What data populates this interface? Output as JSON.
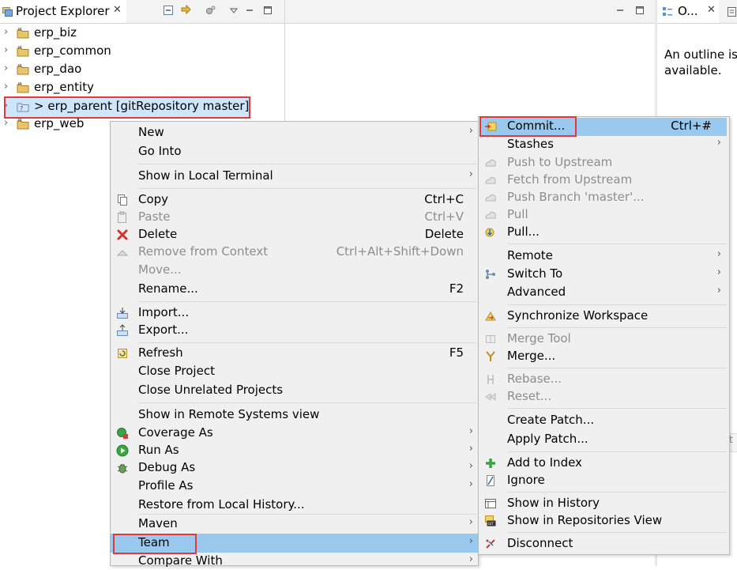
{
  "project_explorer": {
    "title": "Project Explorer",
    "close_glyph": "✕",
    "toolbar_icons": [
      "collapse-all-icon",
      "link-with-editor-icon",
      "filters-icon",
      "view-menu-icon",
      "minimize-icon",
      "maximize-icon"
    ],
    "items": [
      {
        "label": "erp_biz"
      },
      {
        "label": "erp_common"
      },
      {
        "label": "erp_dao"
      },
      {
        "label": "erp_entity"
      },
      {
        "label": "> erp_parent [gitRepository master]",
        "selected": true
      },
      {
        "label": "erp_web"
      }
    ]
  },
  "outline": {
    "title": "O...",
    "close_glyph": "✕",
    "message": "An outline is available.",
    "fragment": "t"
  },
  "editor": {
    "toolbar_icons": [
      "minimize-icon",
      "maximize-icon"
    ]
  },
  "context_menu": {
    "items": [
      {
        "label": "New",
        "submenu": true
      },
      {
        "label": "Go Into"
      },
      {
        "label": "Show in Local Terminal",
        "submenu": true
      },
      {
        "label": "Copy",
        "shortcut": "Ctrl+C",
        "icon": "copy-icon"
      },
      {
        "label": "Paste",
        "shortcut": "Ctrl+V",
        "icon": "paste-icon",
        "disabled": true
      },
      {
        "label": "Delete",
        "shortcut": "Delete",
        "icon": "delete-icon"
      },
      {
        "label": "Remove from Context",
        "shortcut": "Ctrl+Alt+Shift+Down",
        "icon": "remove-context-icon",
        "disabled": true
      },
      {
        "label": "Move...",
        "disabled": true
      },
      {
        "label": "Rename...",
        "shortcut": "F2"
      },
      {
        "label": "Import...",
        "icon": "import-icon"
      },
      {
        "label": "Export...",
        "icon": "export-icon"
      },
      {
        "label": "Refresh",
        "shortcut": "F5",
        "icon": "refresh-icon"
      },
      {
        "label": "Close Project"
      },
      {
        "label": "Close Unrelated Projects"
      },
      {
        "label": "Show in Remote Systems view"
      },
      {
        "label": "Coverage As",
        "submenu": true,
        "icon": "coverage-icon"
      },
      {
        "label": "Run As",
        "submenu": true,
        "icon": "run-icon"
      },
      {
        "label": "Debug As",
        "submenu": true,
        "icon": "debug-icon"
      },
      {
        "label": "Profile As",
        "submenu": true
      },
      {
        "label": "Restore from Local History..."
      },
      {
        "label": "Maven",
        "submenu": true
      },
      {
        "label": "Team",
        "submenu": true,
        "highlighted": true
      },
      {
        "label": "Compare With",
        "submenu": true
      }
    ]
  },
  "team_submenu": {
    "items": [
      {
        "label": "Commit...",
        "shortcut": "Ctrl+#",
        "icon": "commit-icon",
        "highlighted": true
      },
      {
        "label": "Stashes",
        "submenu": true
      },
      {
        "label": "Push to Upstream",
        "icon": "push-icon",
        "disabled": true
      },
      {
        "label": "Fetch from Upstream",
        "icon": "fetch-icon",
        "disabled": true
      },
      {
        "label": "Push Branch 'master'...",
        "icon": "push-branch-icon",
        "disabled": true
      },
      {
        "label": "Pull",
        "icon": "pull-icon",
        "disabled": true
      },
      {
        "label": "Pull...",
        "icon": "pull-dialog-icon"
      },
      {
        "label": "Remote",
        "submenu": true
      },
      {
        "label": "Switch To",
        "submenu": true,
        "icon": "switch-branch-icon"
      },
      {
        "label": "Advanced",
        "submenu": true
      },
      {
        "label": "Synchronize Workspace",
        "icon": "synchronize-icon"
      },
      {
        "label": "Merge Tool",
        "icon": "merge-tool-icon",
        "disabled": true
      },
      {
        "label": "Merge...",
        "icon": "merge-icon"
      },
      {
        "label": "Rebase...",
        "icon": "rebase-icon",
        "disabled": true
      },
      {
        "label": "Reset...",
        "icon": "reset-icon",
        "disabled": true
      },
      {
        "label": "Create Patch..."
      },
      {
        "label": "Apply Patch..."
      },
      {
        "label": "Add to Index",
        "icon": "add-index-icon"
      },
      {
        "label": "Ignore",
        "icon": "ignore-icon"
      },
      {
        "label": "Show in History",
        "icon": "history-icon"
      },
      {
        "label": "Show in Repositories View",
        "icon": "git-repositories-icon"
      },
      {
        "label": "Disconnect",
        "icon": "disconnect-icon"
      }
    ]
  },
  "colors": {
    "selection": "#99c9ef",
    "annotation_border": "#e0393e",
    "menu_bg": "#f0f0f0",
    "disabled_text": "#8d8d8d"
  }
}
